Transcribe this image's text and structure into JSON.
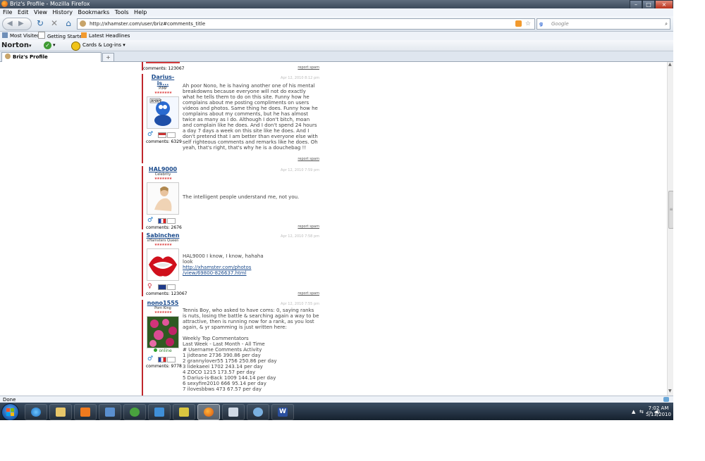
{
  "window": {
    "title": "Briz's Profile - Mozilla Firefox"
  },
  "menu": [
    "File",
    "Edit",
    "View",
    "History",
    "Bookmarks",
    "Tools",
    "Help"
  ],
  "nav": {
    "url": "http://xhamster.com/user/briz#comments_title",
    "search_placeholder": "Google"
  },
  "bookmarks": [
    "Most Visited",
    "Getting Started",
    "Latest Headlines"
  ],
  "norton": {
    "brand": "Norton",
    "cards_label": "Cards & Log-ins"
  },
  "tabs": [
    {
      "label": "Briz's Profile"
    }
  ],
  "comments": [
    {
      "author": "Darius-is...",
      "rank": "PIMP",
      "date": "Apr 12, 2010 8:12 pm",
      "comments_count": "comments: 6329",
      "text": "Ah poor Nono, he is having another one of his mental breakdowns because everyone will not do exactly what he tells them to do on this site. Funny how he complains about me posting compliments on users videos and photos. Same thing he does. Funny how he complains about my comments, but he has almost twice as many as I do. Although I don't bitch, moan and complain like he does. And I don't spend 24 hours a day 7 days a week on this site like he does. And I don't pretend that I am better than everyone else with self righteous comments and remarks like he does. Oh yeah, that's right, that's why he is a douchebag !!",
      "report": "report spam"
    },
    {
      "author": "HAL9000",
      "rank": "Celebrity",
      "date": "Apr 12, 2010 7:59 pm",
      "comments_count": "comments: 2676",
      "text": "The intelligent people understand me, not you.",
      "report": "report spam"
    },
    {
      "author": "Sabinchen",
      "rank": "xHamsters Queen",
      "date": "Apr 12, 2010 7:58 pm",
      "comments_count": "comments: 123067",
      "text1": "HAL9000 I know, I know, hahaha",
      "text2": "look",
      "link1": "http://xhamster.com/photos",
      "link2": "/view/69800-826637.html",
      "report": "report spam"
    },
    {
      "author": "nono1555",
      "rank": "Porn King",
      "date": "Apr 12, 2010 7:55 pm",
      "online": "online",
      "comments_count": "comments: 9778",
      "intro": "Tennis Boy, who asked to have coms: 0, saying ranks is nuts, losing the battle & searching again a way to be attractive, then is running now for a rank, as you lost again, & yr spamming is just written here:",
      "list_title": "Weekly Top Commentators",
      "list_sub": "Last Week - Last Month - All Time",
      "list_header": "# Username Comments Activity",
      "list": [
        "1 jidteane 2736 390.86 per day",
        "2 grannylover55 1756 250.86 per day",
        "3 lidekaeei 1702 243.14 per day",
        "4 ZOCO 1215 173.57 per day",
        "5 Darius-is-Back 1009 144.14 per day",
        "6 sexyfire2010 666 95.14 per day",
        "7 ilovesbbws 473 67.57 per day"
      ]
    }
  ],
  "top_partial": {
    "comments_count": "comments: 123067",
    "report": "report spam"
  },
  "status": {
    "text": "Done"
  },
  "clock": {
    "time": "7:02 AM",
    "date": "5/13/2010"
  },
  "colors": {
    "accent_red": "#c0272d",
    "link": "#1a4a8c",
    "taskbar": "#1c2938"
  }
}
